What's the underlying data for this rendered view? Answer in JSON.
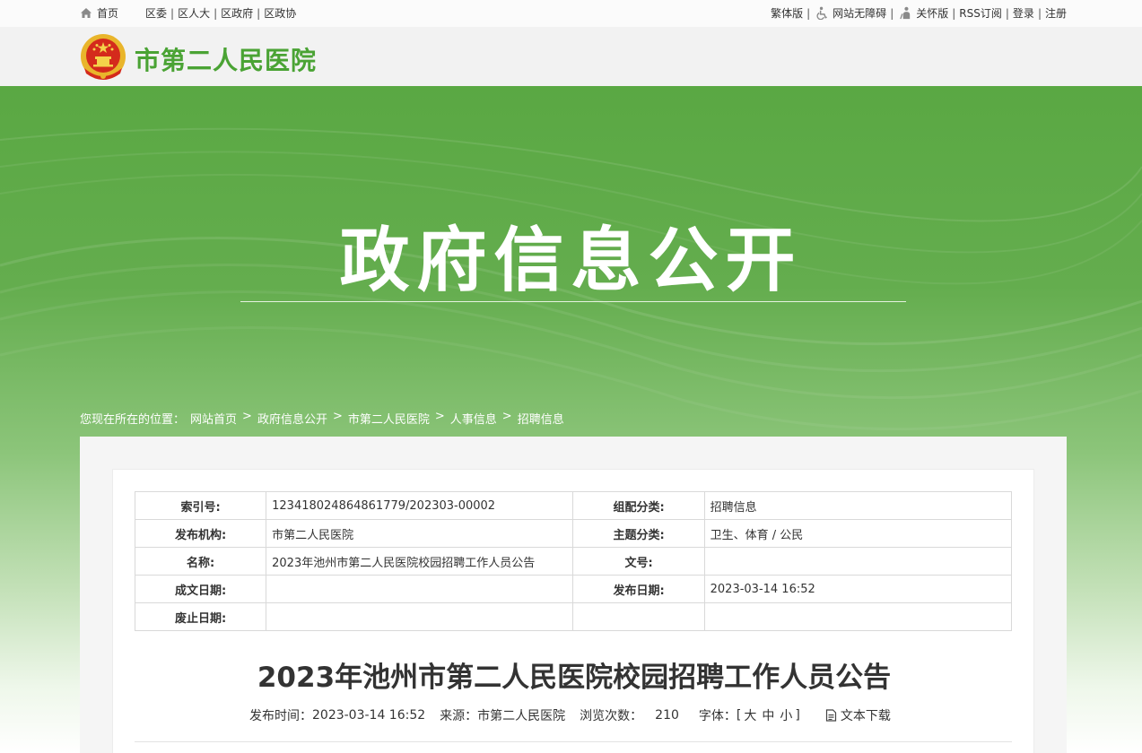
{
  "topbar": {
    "home": "首页",
    "left_links": [
      "区委",
      "区人大",
      "区政府",
      "区政协"
    ],
    "traditional": "繁体版",
    "accessible": "网站无障碍",
    "care": "关怀版",
    "rss": "RSS订阅",
    "login": "登录",
    "register": "注册",
    "icons": {
      "home": "home-icon",
      "accessible": "wheelchair-icon",
      "care": "elderly-care-icon"
    }
  },
  "header": {
    "site_name": "市第二人民医院",
    "emblem": "national-emblem"
  },
  "banner": {
    "title": "政府信息公开"
  },
  "breadcrumb": {
    "prefix": "您现在所在的位置：",
    "items": [
      "网站首页",
      "政府信息公开",
      "市第二人民医院",
      "人事信息",
      "招聘信息"
    ],
    "separator": ">"
  },
  "meta": {
    "rows": [
      {
        "k1": "索引号:",
        "v1": "123418024864861779/202303-00002",
        "k2": "组配分类:",
        "v2": "招聘信息"
      },
      {
        "k1": "发布机构:",
        "v1": "市第二人民医院",
        "k2": "主题分类:",
        "v2": "卫生、体育 / 公民"
      },
      {
        "k1": "名称:",
        "v1": "2023年池州市第二人民医院校园招聘工作人员公告",
        "k2": "文号:",
        "v2": ""
      },
      {
        "k1": "成文日期:",
        "v1": "",
        "k2": "发布日期:",
        "v2": "2023-03-14 16:52"
      },
      {
        "k1": "废止日期:",
        "v1": "",
        "k2": "",
        "v2": ""
      }
    ]
  },
  "article": {
    "title": "2023年池州市第二人民医院校园招聘工作人员公告",
    "publish_label": "发布时间：",
    "publish_time": "2023-03-14 16:52",
    "source_label": "来源：",
    "source": "市第二人民医院",
    "views_label": "浏览次数：",
    "views": "210",
    "font_label": "字体：",
    "font_open": "[",
    "font_large": "大",
    "font_medium": "中",
    "font_small": "小",
    "font_close": "]",
    "download": "文本下载"
  },
  "colors": {
    "brand_green": "#4aa334",
    "banner_green": "#5aa843"
  }
}
